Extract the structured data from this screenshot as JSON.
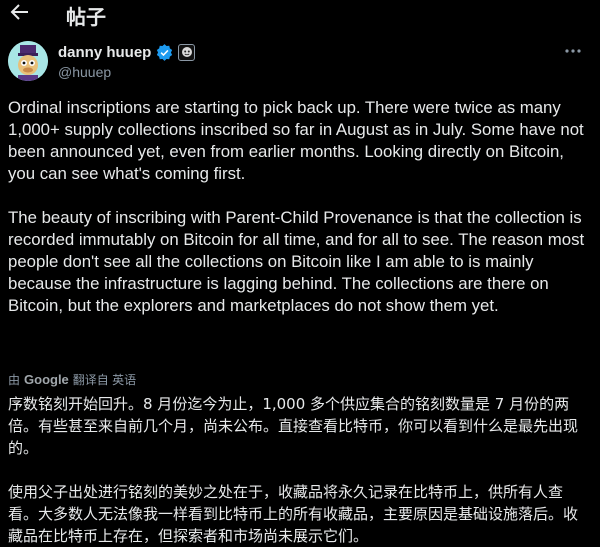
{
  "header": {
    "back_icon": "arrow-left-icon",
    "title": "帖子"
  },
  "author": {
    "display_name": "danny huuep",
    "handle": "@huuep",
    "verified_icon": "verified-badge-icon",
    "affiliate_icon": "affiliate-badge-icon",
    "avatar_icon": "avatar"
  },
  "tweet": {
    "text": "Ordinal inscriptions are starting to pick back up. There were twice as many 1,000+ supply collections inscribed so far in August as in July. Some have not been announced yet, even from earlier months. Looking directly on Bitcoin, you can see what's coming first.\n\nThe beauty of inscribing with Parent-Child Provenance is that the collection is recorded immutably on Bitcoin for all time, and for all to see. The reason most people don't see all the collections on Bitcoin like I am able to is mainly because the infrastructure is lagging behind. The collections are there on Bitcoin, but the explorers and marketplaces do not show them yet."
  },
  "translation": {
    "by_label": "由",
    "provider": "Google",
    "action_label": "翻译自 英语",
    "text": "序数铭刻开始回升。8 月份迄今为止，1,000 多个供应集合的铭刻数量是 7 月份的两倍。有些甚至来自前几个月，尚未公布。直接查看比特币，你可以看到什么是最先出现的。\n\n使用父子出处进行铭刻的美妙之处在于，收藏品将永久记录在比特币上，供所有人查看。大多数人无法像我一样看到比特币上的所有收藏品，主要原因是基础设施落后。收藏品在比特币上存在，但探索者和市场尚未展示它们。"
  },
  "colors": {
    "background": "#000000",
    "text": "#e7e9ea",
    "secondary_text": "#8b98a5",
    "verified_blue": "#1d9bf0"
  }
}
